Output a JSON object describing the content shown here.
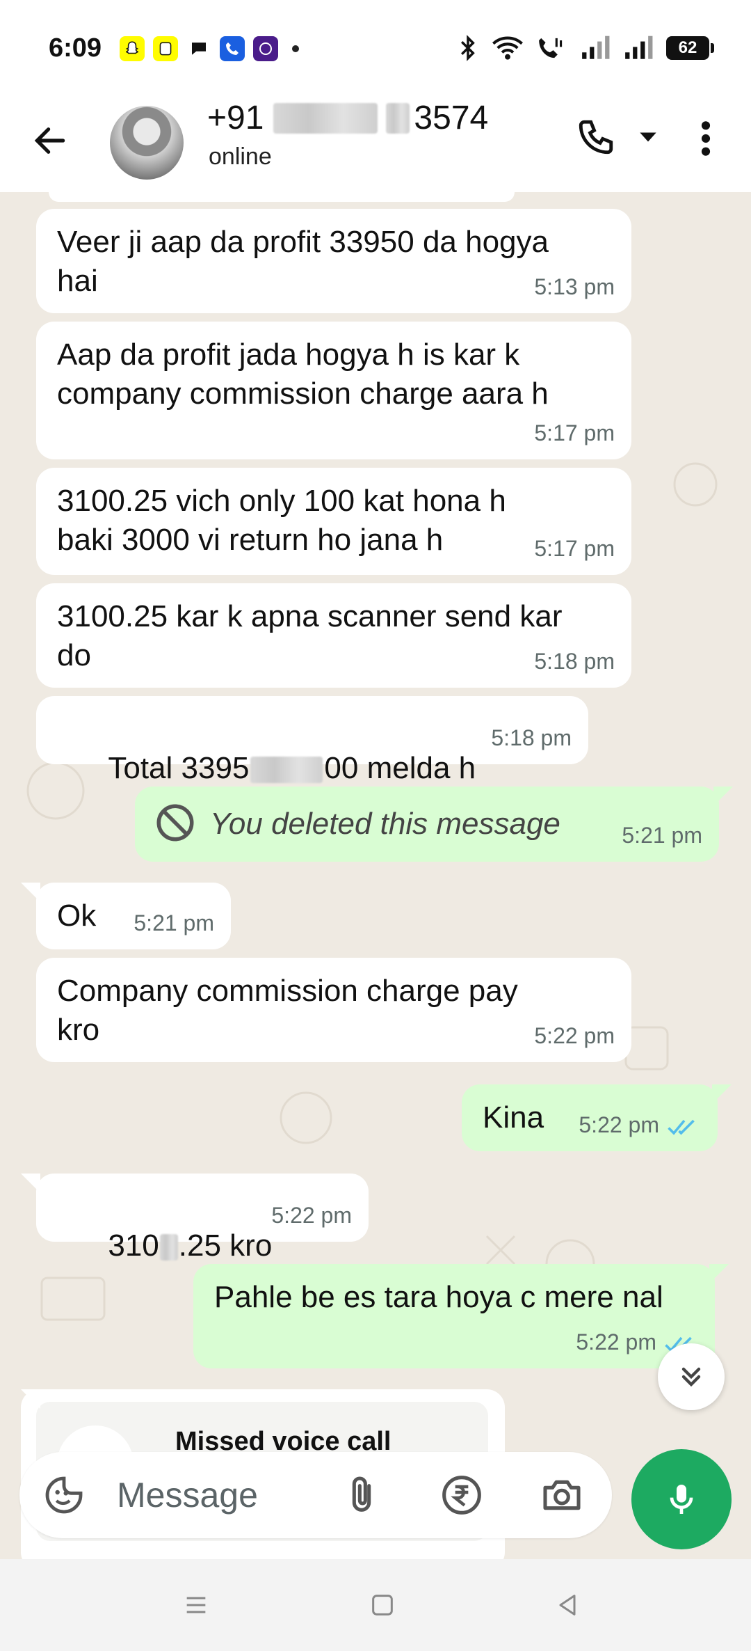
{
  "status_bar": {
    "time": "6:09",
    "battery": "62",
    "apps": [
      "snapchat-icon",
      "snapchat-icon",
      "chat-icon",
      "phone-app-icon",
      "jio-icon"
    ]
  },
  "header": {
    "name_prefix": "+91",
    "name_suffix": "3574",
    "status": "online"
  },
  "messages": [
    {
      "dir": "in",
      "text": "Veer ji aap da profit 33950 da hogya\nhai",
      "time": "5:13 pm"
    },
    {
      "dir": "in",
      "text": "Aap da profit jada hogya h is kar k\ncompany commission charge aara h",
      "time": "5:17 pm"
    },
    {
      "dir": "in",
      "text": "3100.25 vich only 100 kat hona h\nbaki 3000 vi return ho jana h",
      "time": "5:17 pm"
    },
    {
      "dir": "in",
      "text": "3100.25 kar k apna scanner send kar\ndo",
      "time": "5:18 pm"
    },
    {
      "dir": "in",
      "text": "Total 3395",
      "text_tail": "00 melda h",
      "time": "5:18 pm"
    },
    {
      "dir": "out",
      "text": "You deleted this message",
      "time": "5:21 pm",
      "deleted": true
    },
    {
      "dir": "in",
      "text": "Ok",
      "time": "5:21 pm"
    },
    {
      "dir": "in",
      "text": "Company commission charge pay\nkro",
      "time": "5:22 pm"
    },
    {
      "dir": "out",
      "text": "Kina",
      "time": "5:22 pm",
      "read": true
    },
    {
      "dir": "in",
      "text": "310",
      "text_tail": ".25 kro",
      "time": "5:22 pm"
    },
    {
      "dir": "out",
      "text": "Pahle be es tara hoya c mere nal",
      "time": "5:22 pm",
      "read": true
    }
  ],
  "missed_call": {
    "label": "Missed voice call"
  },
  "composer": {
    "placeholder": "Message"
  },
  "colors": {
    "accent": "#1daa61",
    "outgoing": "#d9fdd3",
    "incoming": "#ffffff",
    "read_ticks": "#53bdeb",
    "chat_bg": "#efeae2"
  }
}
